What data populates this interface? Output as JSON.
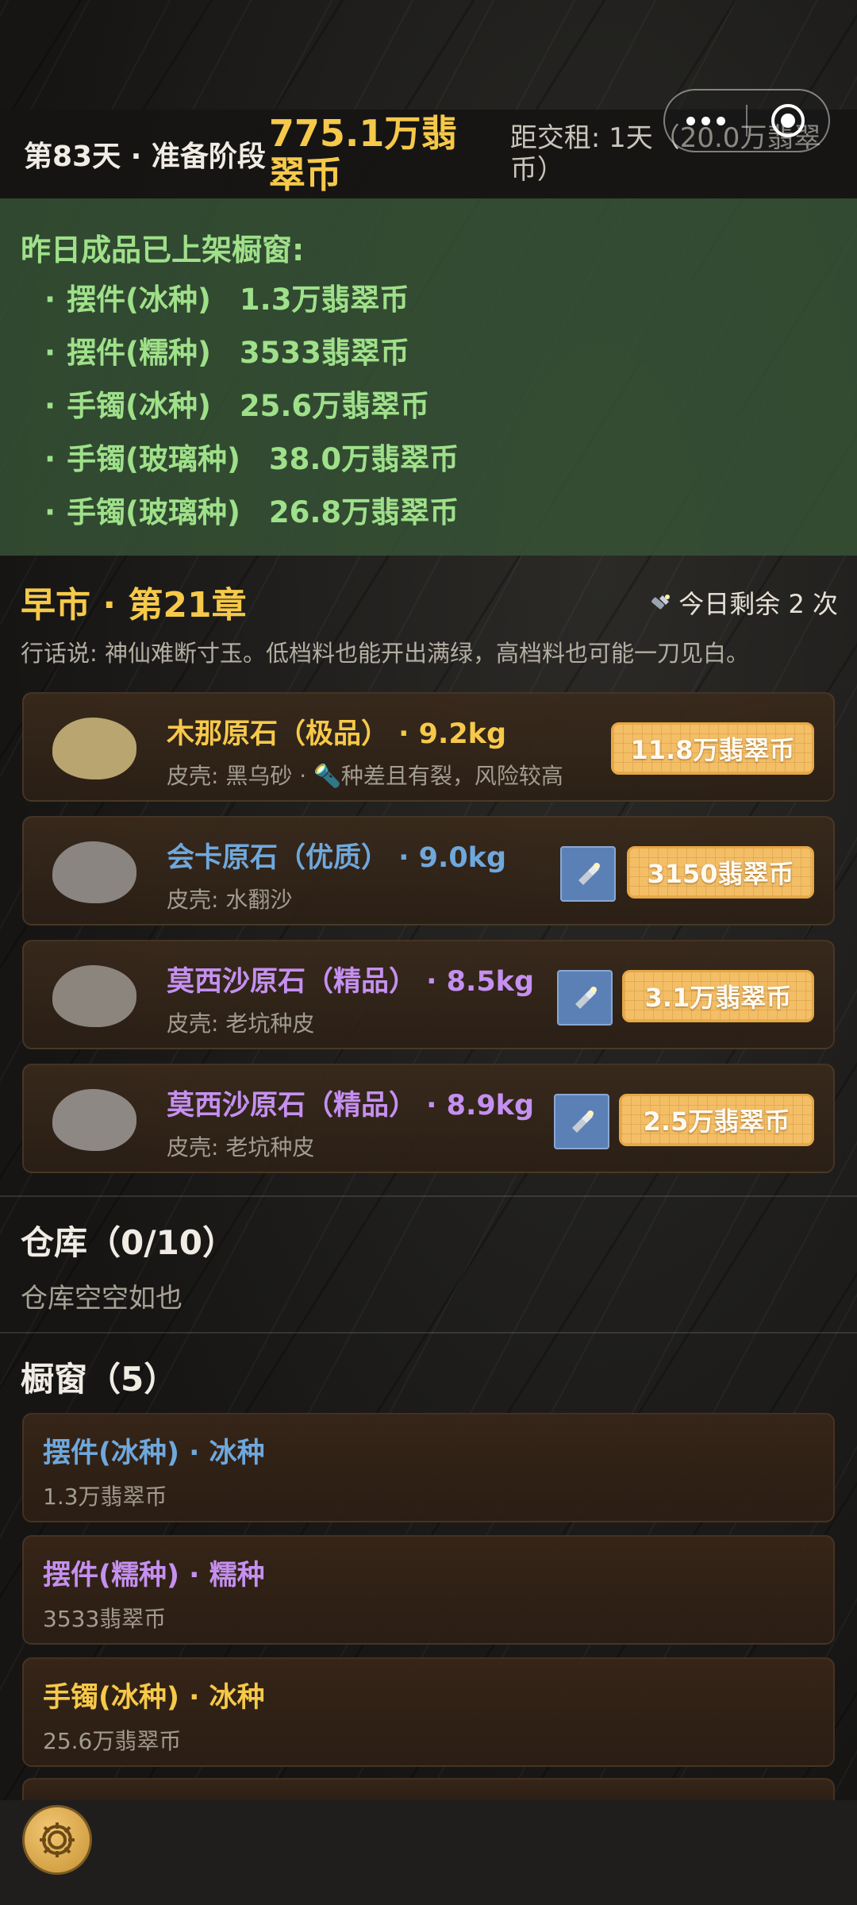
{
  "header": {
    "day_stage": "第83天 · 准备阶段",
    "money": "775.1万翡翠币",
    "rent": "距交租: 1天（20.0万翡翠币）"
  },
  "notice": {
    "title": "昨日成品已上架橱窗:",
    "items": [
      {
        "name": "摆件(冰种)",
        "price": "1.3万翡翠币"
      },
      {
        "name": "摆件(糯种)",
        "price": "3533翡翠币"
      },
      {
        "name": "手镯(冰种)",
        "price": "25.6万翡翠币"
      },
      {
        "name": "手镯(玻璃种)",
        "price": "38.0万翡翠币"
      },
      {
        "name": "手镯(玻璃种)",
        "price": "26.8万翡翠币"
      }
    ]
  },
  "market": {
    "title": "早市 · 第21章",
    "remain": "今日剩余 2 次",
    "saying": "行话说: 神仙难断寸玉。低档料也能开出满绿，高档料也可能一刀见白。",
    "stones": [
      {
        "name": "木那原石（极品） · 9.2kg",
        "skin": "皮壳: 黑乌砂 · 🔦种差且有裂，风险较高",
        "price": "11.8万翡翠币",
        "color": "#f6c94a",
        "stone_color": "#b8a570"
      },
      {
        "name": "会卡原石（优质） · 9.0kg",
        "skin": "皮壳: 水翻沙",
        "price": "3150翡翠币",
        "color": "#6fa8dc",
        "stone_color": "#8a8580"
      },
      {
        "name": "莫西沙原石（精品） · 8.5kg",
        "skin": "皮壳: 老坑种皮",
        "price": "3.1万翡翠币",
        "color": "#c590f0",
        "stone_color": "#8c857e"
      },
      {
        "name": "莫西沙原石（精品） · 8.9kg",
        "skin": "皮壳: 老坑种皮",
        "price": "2.5万翡翠币",
        "color": "#c590f0",
        "stone_color": "#8e8884"
      }
    ]
  },
  "warehouse": {
    "title": "仓库（0/10）",
    "empty": "仓库空空如也"
  },
  "showcase": {
    "title": "橱窗（5）",
    "items": [
      {
        "name": "摆件(冰种) · 冰种",
        "price": "1.3万翡翠币",
        "color": "#6fa8dc"
      },
      {
        "name": "摆件(糯种) · 糯种",
        "price": "3533翡翠币",
        "color": "#c590f0"
      },
      {
        "name": "手镯(冰种) · 冰种",
        "price": "25.6万翡翠币",
        "color": "#f6c94a"
      }
    ]
  },
  "icons": {
    "menu": "more-dots-icon",
    "close": "target-icon",
    "torch": "flashlight-icon",
    "settings": "gear-icon"
  }
}
